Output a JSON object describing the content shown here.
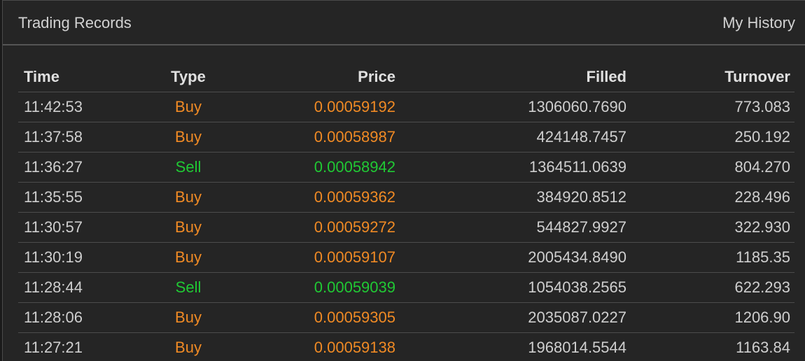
{
  "header": {
    "title": "Trading Records",
    "history_link": "My History"
  },
  "colors": {
    "buy": "#f08a24",
    "sell": "#20c934",
    "panel_bg": "#252525",
    "text": "#cfcfcf"
  },
  "table": {
    "columns": [
      "Time",
      "Type",
      "Price",
      "Filled",
      "Turnover"
    ],
    "rows": [
      {
        "time": "11:42:53",
        "type": "Buy",
        "price": "0.00059192",
        "filled": "1306060.7690",
        "turnover": "773.083"
      },
      {
        "time": "11:37:58",
        "type": "Buy",
        "price": "0.00058987",
        "filled": "424148.7457",
        "turnover": "250.192"
      },
      {
        "time": "11:36:27",
        "type": "Sell",
        "price": "0.00058942",
        "filled": "1364511.0639",
        "turnover": "804.270"
      },
      {
        "time": "11:35:55",
        "type": "Buy",
        "price": "0.00059362",
        "filled": "384920.8512",
        "turnover": "228.496"
      },
      {
        "time": "11:30:57",
        "type": "Buy",
        "price": "0.00059272",
        "filled": "544827.9927",
        "turnover": "322.930"
      },
      {
        "time": "11:30:19",
        "type": "Buy",
        "price": "0.00059107",
        "filled": "2005434.8490",
        "turnover": "1185.35"
      },
      {
        "time": "11:28:44",
        "type": "Sell",
        "price": "0.00059039",
        "filled": "1054038.2565",
        "turnover": "622.293"
      },
      {
        "time": "11:28:06",
        "type": "Buy",
        "price": "0.00059305",
        "filled": "2035087.0227",
        "turnover": "1206.90"
      },
      {
        "time": "11:27:21",
        "type": "Buy",
        "price": "0.00059138",
        "filled": "1968014.5544",
        "turnover": "1163.84"
      }
    ]
  }
}
